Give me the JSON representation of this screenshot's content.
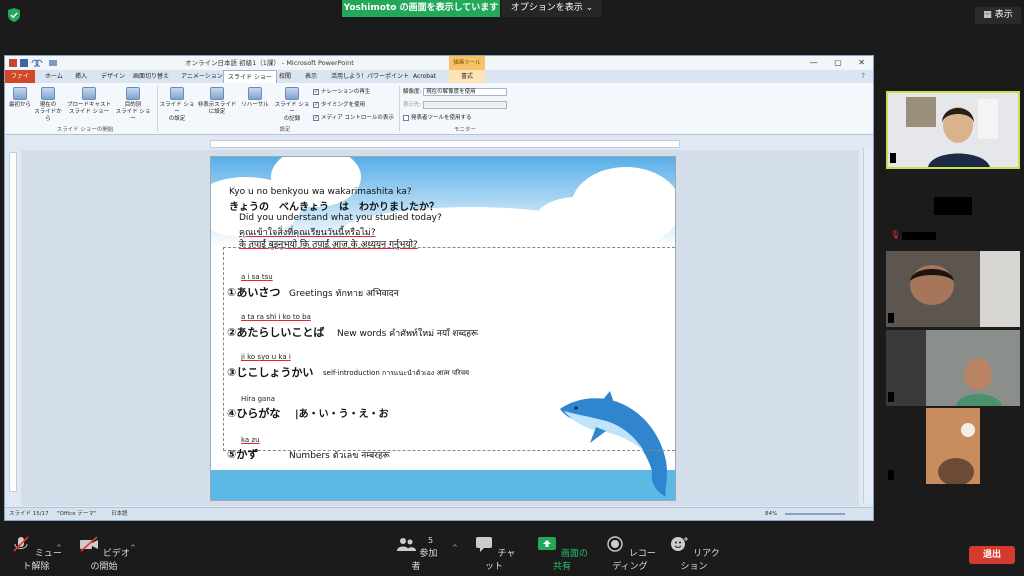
{
  "banner": {
    "sharing": "Yoshimoto の画面を表示しています",
    "options": "オプションを表示"
  },
  "view_button": "表示",
  "ppt": {
    "title": "オンライン日本語  初級1（1課） - Microsoft PowerPoint",
    "drawing_tools": "描画ツール",
    "tabs": [
      "ファイル",
      "ホーム",
      "挿入",
      "デザイン",
      "画面切り替え",
      "アニメーション",
      "スライド ショー",
      "校閲",
      "表示",
      "活用しよう！パワーポイント",
      "Acrobat",
      "書式"
    ],
    "ribbon": {
      "from_start": "最初から",
      "from_current": "現在の\nスライドから",
      "broadcast": "ブロードキャスト\nスライド ショー",
      "custom": "目的別\nスライド ショー",
      "setup": "スライド ショー\nの設定",
      "hide": "非表示スライド\nに設定",
      "rehearse": "リハーサル",
      "record": "スライド ショー\nの記録",
      "group_start": "スライド ショーの開始",
      "group_setup": "設定",
      "group_monitor": "モニター",
      "chk_narration": "ナレーションの再生",
      "chk_timing": "タイミングを使用",
      "chk_media": "メディア コントロールの表示",
      "resolution_label": "解像度:",
      "resolution_value": "現在の解像度を使用",
      "display_label": "表示先:",
      "presenter_view": "発表者ツールを使用する"
    },
    "status": {
      "slide": "スライド 15/17",
      "theme": "\"Office テーマ\"",
      "lang": "日本語",
      "zoom": "84%"
    }
  },
  "slide": {
    "q_romaji": "Kyo u no  benkyou    wa   wakarimashita ka?",
    "q_kana": "きょうの　べんきょう　は　わかりましたか？",
    "q_en": "Did you understand what you studied today?",
    "q_th": "คุณเข้าใจสิ่งที่คุณเรียนวันนี้หรือไม่?",
    "q_ne": "के तपाईं बुझ्नुभयो कि तपाईं आज के अध्ययन गर्नुभयो?",
    "items": [
      {
        "ruby": "a i sa tsu",
        "jp": "①あいさつ",
        "rest": "Greetings   ทักทาย   अभिवादन"
      },
      {
        "ruby": "a ta ra shi i  ko to ba",
        "jp": "②あたらしいことば",
        "rest": "New words คำศัพท์ใหม่ नयाँ शब्दहरू"
      },
      {
        "ruby": "ji ko syo u ka i",
        "jp": "③じこしょうかい",
        "rest": "self-introduction  การแนะนำตัวเอง  आत्म परिचय"
      },
      {
        "ruby": "Hira gana",
        "jp": "④ひらがな",
        "rest": "|あ・い・う・え・お"
      },
      {
        "ruby": "ka zu",
        "jp": "⑤かず",
        "rest": "Numbers ตัวเลข   नम्बरहरू"
      }
    ]
  },
  "participants": [
    "",
    "",
    "",
    "",
    ""
  ],
  "toolbar": {
    "mute": "ミュート解除",
    "video": "ビデオの開始",
    "participants": "参加者",
    "participants_count": "5",
    "chat": "チャット",
    "share": "画面の共有",
    "record": "レコーディング",
    "reaction": "リアクション",
    "leave": "退出"
  }
}
